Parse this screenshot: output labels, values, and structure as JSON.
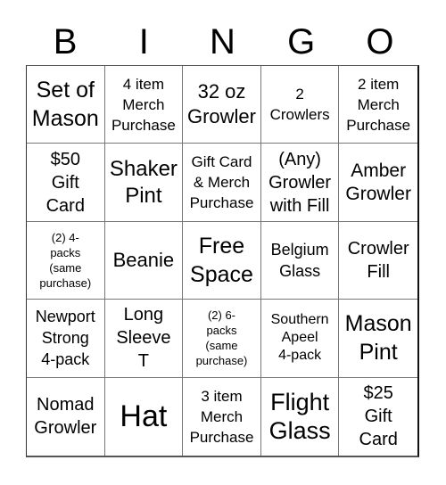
{
  "header": {
    "letters": [
      "B",
      "I",
      "N",
      "G",
      "O"
    ]
  },
  "board": {
    "cells": [
      "Set of\nMason",
      "4 item\nMerch\nPurchase",
      "32 oz\nGrowler",
      "2\nCrowlers",
      "2 item\nMerch\nPurchase",
      "$50\nGift\nCard",
      "Shaker\nPint",
      "Gift Card\n& Merch\nPurchase",
      "(Any)\nGrowler\nwith Fill",
      "Amber\nGrowler",
      "(2) 4-\npacks\n(same\npurchase)",
      "Beanie",
      "Free\nSpace",
      "Belgium\nGlass",
      "Crowler\nFill",
      "Newport\nStrong\n4-pack",
      "Long\nSleeve\nT",
      "(2) 6-\npacks\n(same\npurchase)",
      "Southern\nApeel\n4-pack",
      "Mason\nPint",
      "Nomad\nGrowler",
      "Hat",
      "3 item\nMerch\nPurchase",
      "Flight\nGlass",
      "$25\nGift\nCard"
    ]
  }
}
